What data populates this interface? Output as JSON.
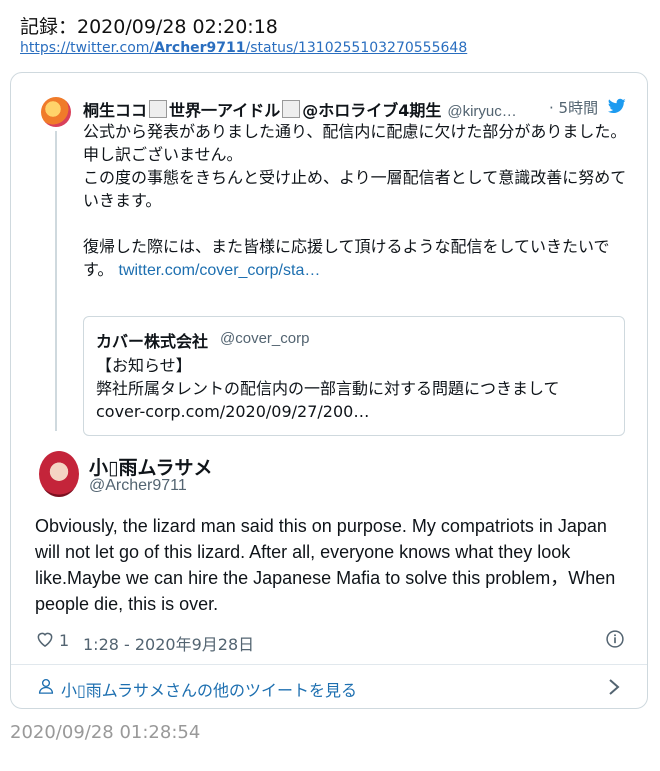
{
  "header": {
    "record_label": "記録：2020/09/28 02:20:18",
    "link_prefix": "https://twitter.com/",
    "link_user": "Archer9711",
    "link_suffix": "/status/1310255103270555648"
  },
  "quoted": {
    "name_part1": "桐生ココ",
    "name_part2": "世界一アイドル",
    "name_part3": "@ホロライブ4期生",
    "handle": "@kiryuc…",
    "time": "· 5時間",
    "body": "公式から発表がありました通り、配信内に配慮に欠けた部分がありました。\n申し訳ございません。\nこの度の事態をきちんと受け止め、より一層配信者として意識改善に努めていきます。\n\n復帰した際には、また皆様に応援して頂けるような配信をしていきたいです。 ",
    "link": "twitter.com/cover_corp/sta…",
    "inner": {
      "name": "カバー株式会社",
      "handle": "@cover_corp",
      "body": "【お知らせ】\n弊社所属タレントの配信内の一部言動に対する問題につきまして\ncover-corp.com/2020/09/27/200…"
    }
  },
  "main": {
    "name": "小▯雨ムラサメ",
    "handle": "@Archer9711",
    "text": "Obviously, the lizard man said this on purpose. My compatriots in Japan will not let go of this lizard. After all, everyone knows what they look like.Maybe we can hire the Japanese Mafia to solve this problem，When people die, this is over.",
    "likes": "1",
    "datetime": "1:28 - 2020年9月28日",
    "more_tweets": "小▯雨ムラサメさんの他のツイートを見る"
  },
  "footer": {
    "timestamp": "2020/09/28 01:28:54"
  },
  "colors": {
    "link": "#1d6fb0",
    "border": "#cfd9de",
    "muted": "#536471"
  }
}
